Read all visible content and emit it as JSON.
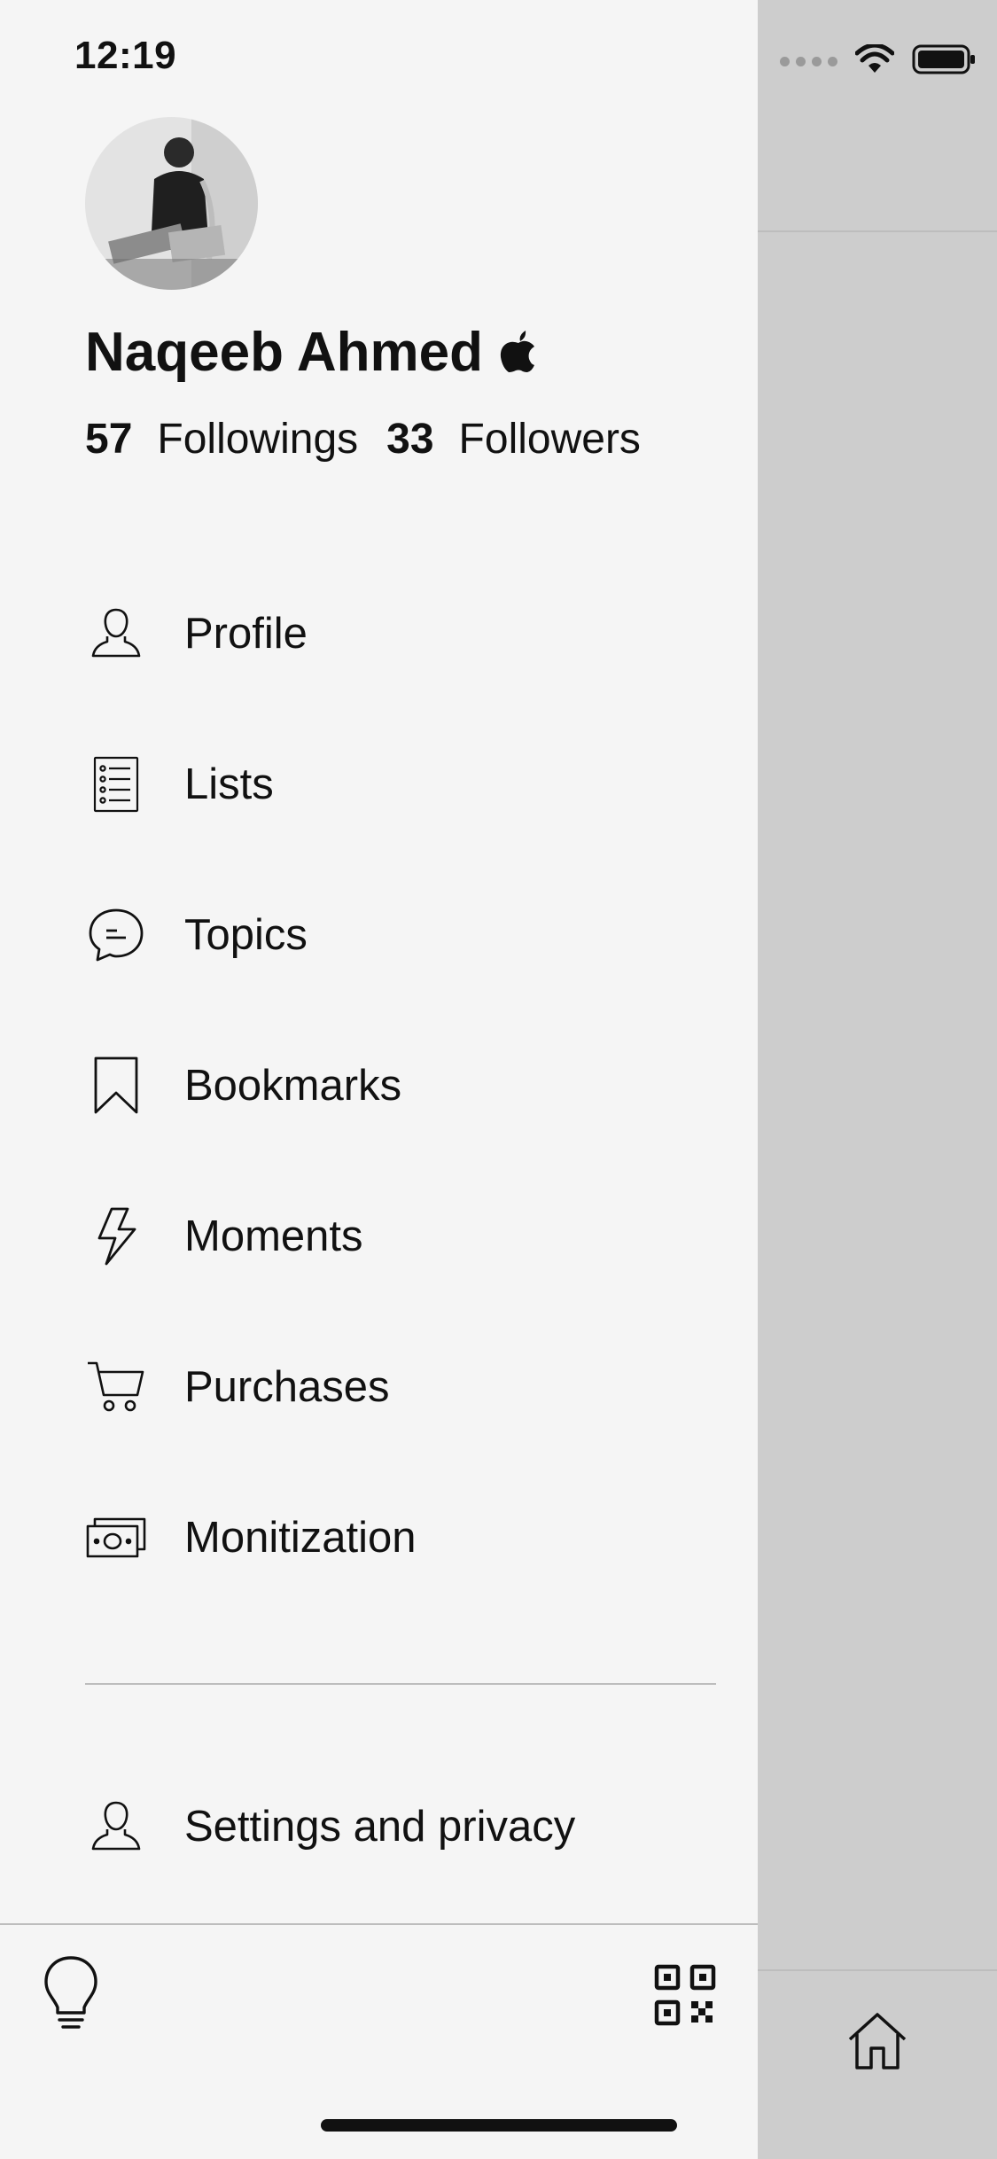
{
  "status_bar": {
    "time": "12:19"
  },
  "profile": {
    "name": "Naqeeb Ahmed",
    "badge_icon": "apple-logo-icon",
    "followings_count": "57",
    "followings_label": "Followings",
    "followers_count": "33",
    "followers_label": "Followers"
  },
  "menu": {
    "items": [
      {
        "label": "Profile",
        "icon": "person-icon"
      },
      {
        "label": "Lists",
        "icon": "list-icon"
      },
      {
        "label": "Topics",
        "icon": "chat-bubble-icon"
      },
      {
        "label": "Bookmarks",
        "icon": "bookmark-icon"
      },
      {
        "label": "Moments",
        "icon": "lightning-icon"
      },
      {
        "label": "Purchases",
        "icon": "cart-icon"
      },
      {
        "label": "Monitization",
        "icon": "money-icon"
      }
    ],
    "settings_label": "Settings and privacy"
  },
  "bottom_bar": {
    "left_icon": "lightbulb-icon",
    "right_icon": "qr-code-icon",
    "backdrop_icon": "home-icon"
  },
  "colors": {
    "drawer_bg": "#f5f5f5",
    "backdrop_bg": "#cdcdcd",
    "text": "#111111"
  }
}
